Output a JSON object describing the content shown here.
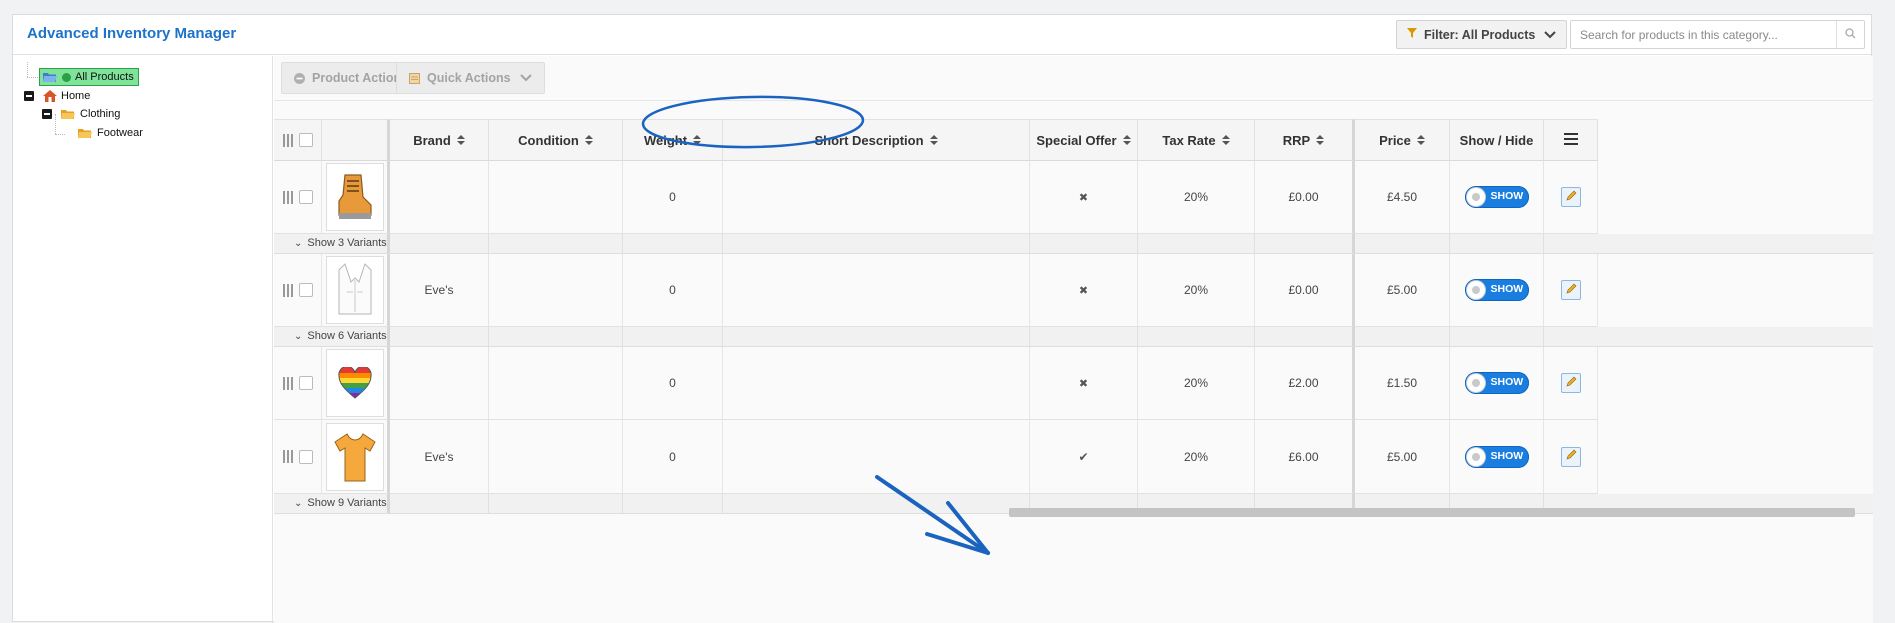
{
  "app": {
    "title": "Advanced Inventory Manager"
  },
  "header": {
    "filter_label": "Filter: All Products",
    "search_placeholder": "Search for products in this category..."
  },
  "sidebar": {
    "nodes": [
      {
        "label": "All Products",
        "icon": "folder-open-icon",
        "selected": true
      },
      {
        "label": "Home",
        "icon": "home-icon"
      },
      {
        "label": "Clothing",
        "icon": "folder-icon"
      },
      {
        "label": "Footwear",
        "icon": "folder-icon"
      }
    ]
  },
  "toolbar": {
    "product_actions": "Product Actions",
    "quick_actions": "Quick Actions"
  },
  "table": {
    "columns": [
      "Brand",
      "Condition",
      "Weight",
      "Short Description",
      "Special Offer",
      "Tax Rate",
      "RRP",
      "Price",
      "Show / Hide"
    ],
    "rows": [
      {
        "product": "boot-image",
        "brand": "",
        "condition": "",
        "weight": "0",
        "short_description": "",
        "special_offer": "✖",
        "tax_rate": "20%",
        "rrp": "£0.00",
        "price": "£4.50",
        "visibility": "SHOW",
        "variants": "Show 3 Variants"
      },
      {
        "product": "waistcoat-image",
        "brand": "Eve's",
        "condition": "",
        "weight": "0",
        "short_description": "",
        "special_offer": "✖",
        "tax_rate": "20%",
        "rrp": "£0.00",
        "price": "£5.00",
        "visibility": "SHOW",
        "variants": "Show 6 Variants"
      },
      {
        "product": "rainbow-heart-image",
        "brand": "",
        "condition": "",
        "weight": "0",
        "short_description": "",
        "special_offer": "✖",
        "tax_rate": "20%",
        "rrp": "£2.00",
        "price": "£1.50",
        "visibility": "SHOW",
        "variants": ""
      },
      {
        "product": "orange-tshirt-image",
        "brand": "Eve's",
        "condition": "",
        "weight": "0",
        "short_description": "",
        "special_offer": "✔",
        "tax_rate": "20%",
        "rrp": "£6.00",
        "price": "£5.00",
        "visibility": "SHOW",
        "variants": "Show 9 Variants"
      }
    ]
  },
  "colors": {
    "accent": "#1d73c9",
    "toggle": "#1a7ee0",
    "annotation": "#1a64c0"
  }
}
